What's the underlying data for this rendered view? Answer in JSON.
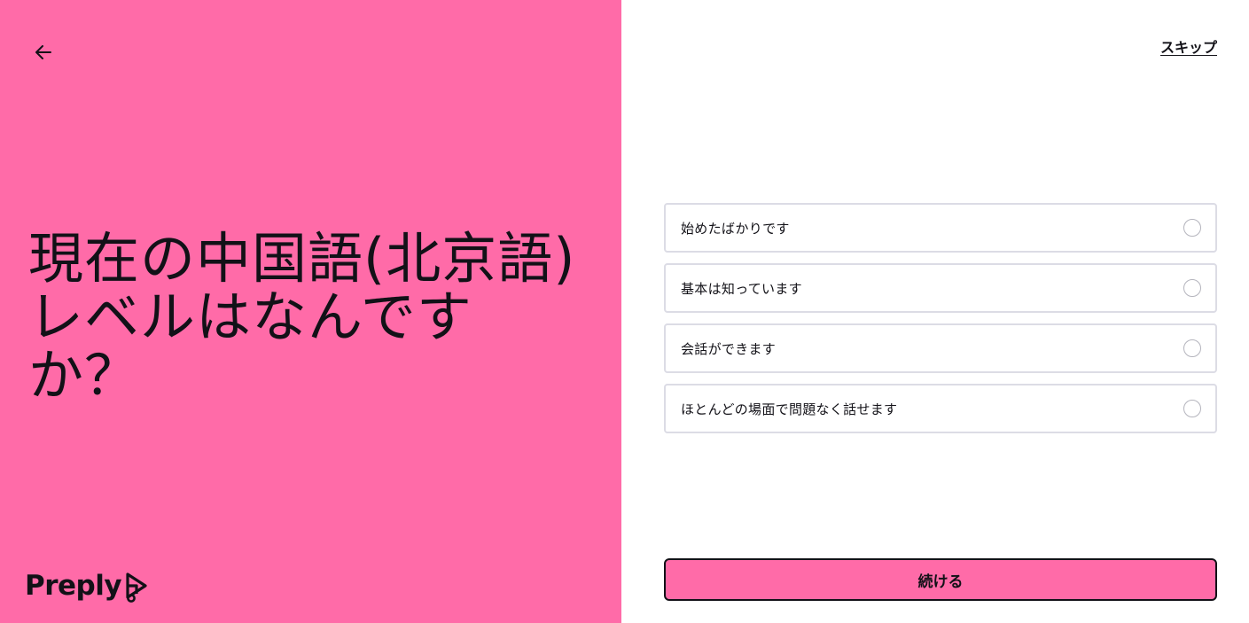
{
  "header": {
    "back_icon": "arrow-left-icon",
    "skip_label": "スキップ"
  },
  "question": {
    "line1": "現在の中国語(北京語)",
    "line2": "レベルはなんです",
    "line3": "か？"
  },
  "brand": {
    "logo_text": "Preply",
    "logo_icon": "preply-play-icon",
    "accent_color": "#ff6ba8"
  },
  "options": [
    {
      "label": "始めたばかりです",
      "selected": false
    },
    {
      "label": "基本は知っています",
      "selected": false
    },
    {
      "label": "会話ができます",
      "selected": false
    },
    {
      "label": "ほとんどの場面で問題なく話せます",
      "selected": false
    }
  ],
  "footer": {
    "continue_label": "続ける"
  }
}
